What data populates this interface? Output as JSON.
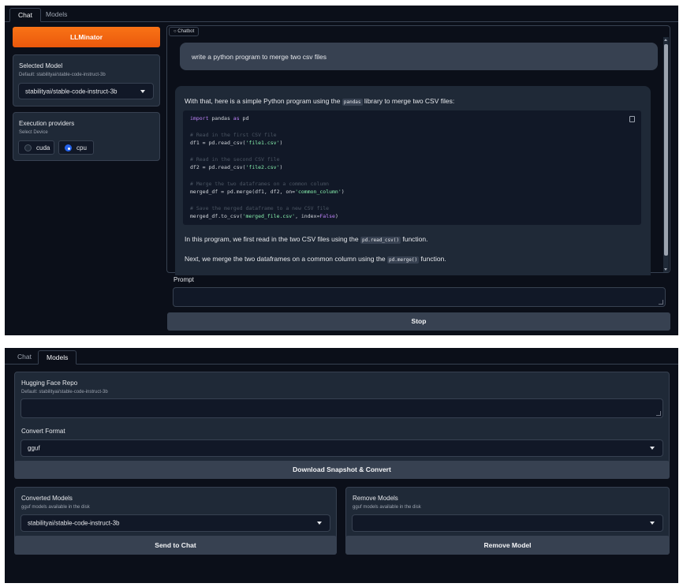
{
  "chat_panel": {
    "tabs": [
      "Chat",
      "Models"
    ],
    "active_tab": "Chat",
    "app_button_label": "LLMinator",
    "selected_model": {
      "label": "Selected Model",
      "sublabel": "Default: stabilityai/stable-code-instruct-3b",
      "value": "stabilityai/stable-code-instruct-3b"
    },
    "execution_providers": {
      "label": "Execution providers",
      "sublabel": "Select Device",
      "options": [
        "cuda",
        "cpu"
      ],
      "selected": "cpu"
    },
    "chatbot": {
      "label": "Chatbot",
      "user_message": "write a python program to merge two csv files",
      "bot_intro_before": "With that, here is a simple Python program using the",
      "bot_intro_code": "pandas",
      "bot_intro_after": "library to merge two CSV files:",
      "code_lines": [
        "import pandas as pd",
        "",
        "# Read in the first CSV file",
        "df1 = pd.read_csv('file1.csv')",
        "",
        "# Read in the second CSV file",
        "df2 = pd.read_csv('file2.csv')",
        "",
        "# Merge the two dataframes on a common column",
        "merged_df = pd.merge(df1, df2, on='common_column')",
        "",
        "# Save the merged dataframe to a new CSV file",
        "merged_df.to_csv('merged_file.csv', index=False)"
      ],
      "para1_before": "In this program, we first read in the two CSV files using the",
      "para1_code": "pd.read_csv()",
      "para1_after": "function.",
      "para2_before": "Next, we merge the two dataframes on a common column using the",
      "para2_code": "pd.merge()",
      "para2_after": "function."
    },
    "prompt": {
      "label": "Prompt",
      "value": ""
    },
    "stop_button_label": "Stop"
  },
  "models_panel": {
    "tabs": [
      "Chat",
      "Models"
    ],
    "active_tab": "Models",
    "hf_repo": {
      "label": "Hugging Face Repo",
      "sublabel": "Default: stabilityai/stable-code-instruct-3b",
      "value": ""
    },
    "convert_format": {
      "label": "Convert Format",
      "value": "gguf"
    },
    "download_button_label": "Download Snapshot & Convert",
    "converted_models": {
      "label": "Converted Models",
      "sublabel": "gguf models available in the disk",
      "value": "stabilityai/stable-code-instruct-3b"
    },
    "remove_models": {
      "label": "Remove Models",
      "sublabel": "gguf models available in the disk",
      "value": ""
    },
    "send_button_label": "Send to Chat",
    "remove_button_label": "Remove Model"
  },
  "colors": {
    "background": "#0b0f19",
    "block": "#1f2937",
    "accent_orange": "#f97316",
    "radio_selected": "#2563eb"
  }
}
